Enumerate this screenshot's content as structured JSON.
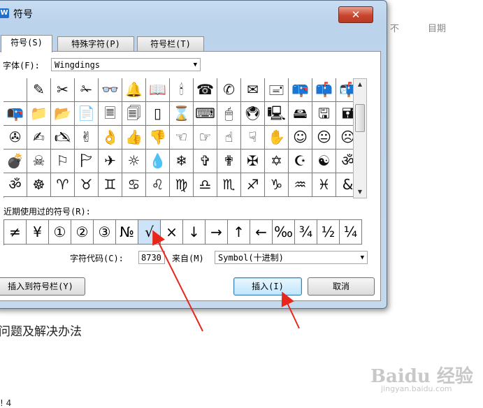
{
  "background": {
    "top_text_1": "不",
    "top_text_2": "目期",
    "document_line": "问题及解决办法",
    "watermark": "Baidu 经验",
    "watermark_url": "jingyan.baidu.com",
    "bottom_mark": "! 4"
  },
  "dialog": {
    "title": "符号",
    "app_icon_letter": "W",
    "close_label": "✕",
    "tabs": [
      "符号(S)",
      "特殊字符(P)",
      "符号栏(T)"
    ],
    "font_label": "字体(F):",
    "font_value": "Wingdings",
    "recent_label": "近期使用过的符号(R):",
    "symbols": [
      [
        "",
        "✎",
        "✂",
        "✁",
        "👓",
        "🔔",
        "📖",
        "🕯",
        "☎",
        "✆",
        "✉",
        "🖃",
        "📪",
        "📫",
        "📬"
      ],
      [
        "📭",
        "📁",
        "📂",
        "📄",
        "🗏",
        "🗐",
        "▯",
        "⌛",
        "⌨",
        "🖱",
        "🖲",
        "🖳",
        "🖴",
        "🖫",
        "🖬"
      ],
      [
        "✇",
        "✍",
        "🖎",
        "✌",
        "👌",
        "👍",
        "👎",
        "☜",
        "☞",
        "☝",
        "☟",
        "✋",
        "☺",
        "😐",
        "☹"
      ],
      [
        "💣",
        "☠",
        "⚐",
        "🏱",
        "✈",
        "☼",
        "💧",
        "❄",
        "✞",
        "✟",
        "✠",
        "✡",
        "☪",
        "☯",
        "ॐ"
      ],
      [
        "ॐ",
        "☸",
        "♈",
        "♉",
        "♊",
        "♋",
        "♌",
        "♍",
        "♎",
        "♏",
        "♐",
        "♑",
        "♒",
        "♓",
        "&"
      ]
    ],
    "recent_symbols": [
      "≠",
      "¥",
      "①",
      "②",
      "③",
      "№",
      "√",
      "×",
      "↓",
      "→",
      "↑",
      "←",
      "‰",
      "¾",
      "½",
      "¼"
    ],
    "selected_recent_index": 6,
    "char_code_label": "字符代码(C):",
    "char_code_value": "8730",
    "from_label": "来自(M)",
    "from_value": "Symbol(十进制)",
    "insert_to_bar_label": "插入到符号栏(Y)",
    "insert_label": "插入(I)",
    "cancel_label": "取消"
  },
  "colors": {
    "arrow": "#e8261c",
    "selection": "#cde3f8"
  }
}
